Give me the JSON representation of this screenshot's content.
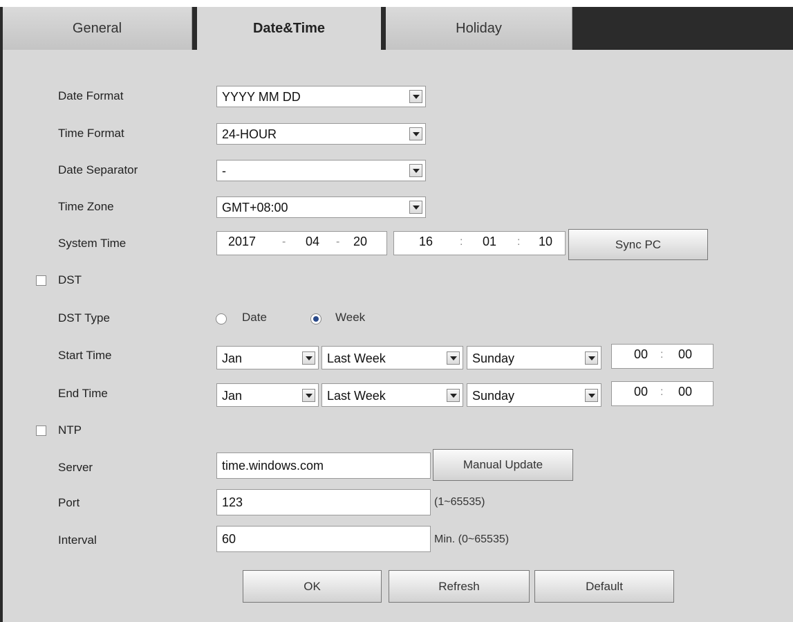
{
  "tabs": [
    {
      "label": "General"
    },
    {
      "label": "Date&Time"
    },
    {
      "label": "Holiday"
    }
  ],
  "form": {
    "date_format": {
      "label": "Date Format",
      "value": "YYYY MM DD"
    },
    "time_format": {
      "label": "Time Format",
      "value": "24-HOUR"
    },
    "date_separator": {
      "label": "Date Separator",
      "value": "-"
    },
    "time_zone": {
      "label": "Time Zone",
      "value": "GMT+08:00"
    },
    "system_time": {
      "label": "System Time",
      "year": "2017",
      "month": "04",
      "day": "20",
      "hour": "16",
      "minute": "01",
      "second": "10",
      "date_sep": "-",
      "time_sep": ":",
      "sync_label": "Sync PC"
    },
    "dst": {
      "label": "DST",
      "type_label": "DST Type",
      "option_date": "Date",
      "option_week": "Week",
      "start": {
        "label": "Start Time",
        "month": "Jan",
        "week": "Last Week",
        "day": "Sunday",
        "hour": "00",
        "minute": "00"
      },
      "end": {
        "label": "End Time",
        "month": "Jan",
        "week": "Last Week",
        "day": "Sunday",
        "hour": "00",
        "minute": "00"
      },
      "time_sep": ":"
    },
    "ntp": {
      "label": "NTP",
      "server_label": "Server",
      "server_value": "time.windows.com",
      "manual_update_label": "Manual Update",
      "port_label": "Port",
      "port_value": "123",
      "port_hint": "(1~65535)",
      "interval_label": "Interval",
      "interval_value": "60",
      "interval_hint": "Min. (0~65535)"
    }
  },
  "actions": {
    "ok": "OK",
    "refresh": "Refresh",
    "default": "Default"
  }
}
